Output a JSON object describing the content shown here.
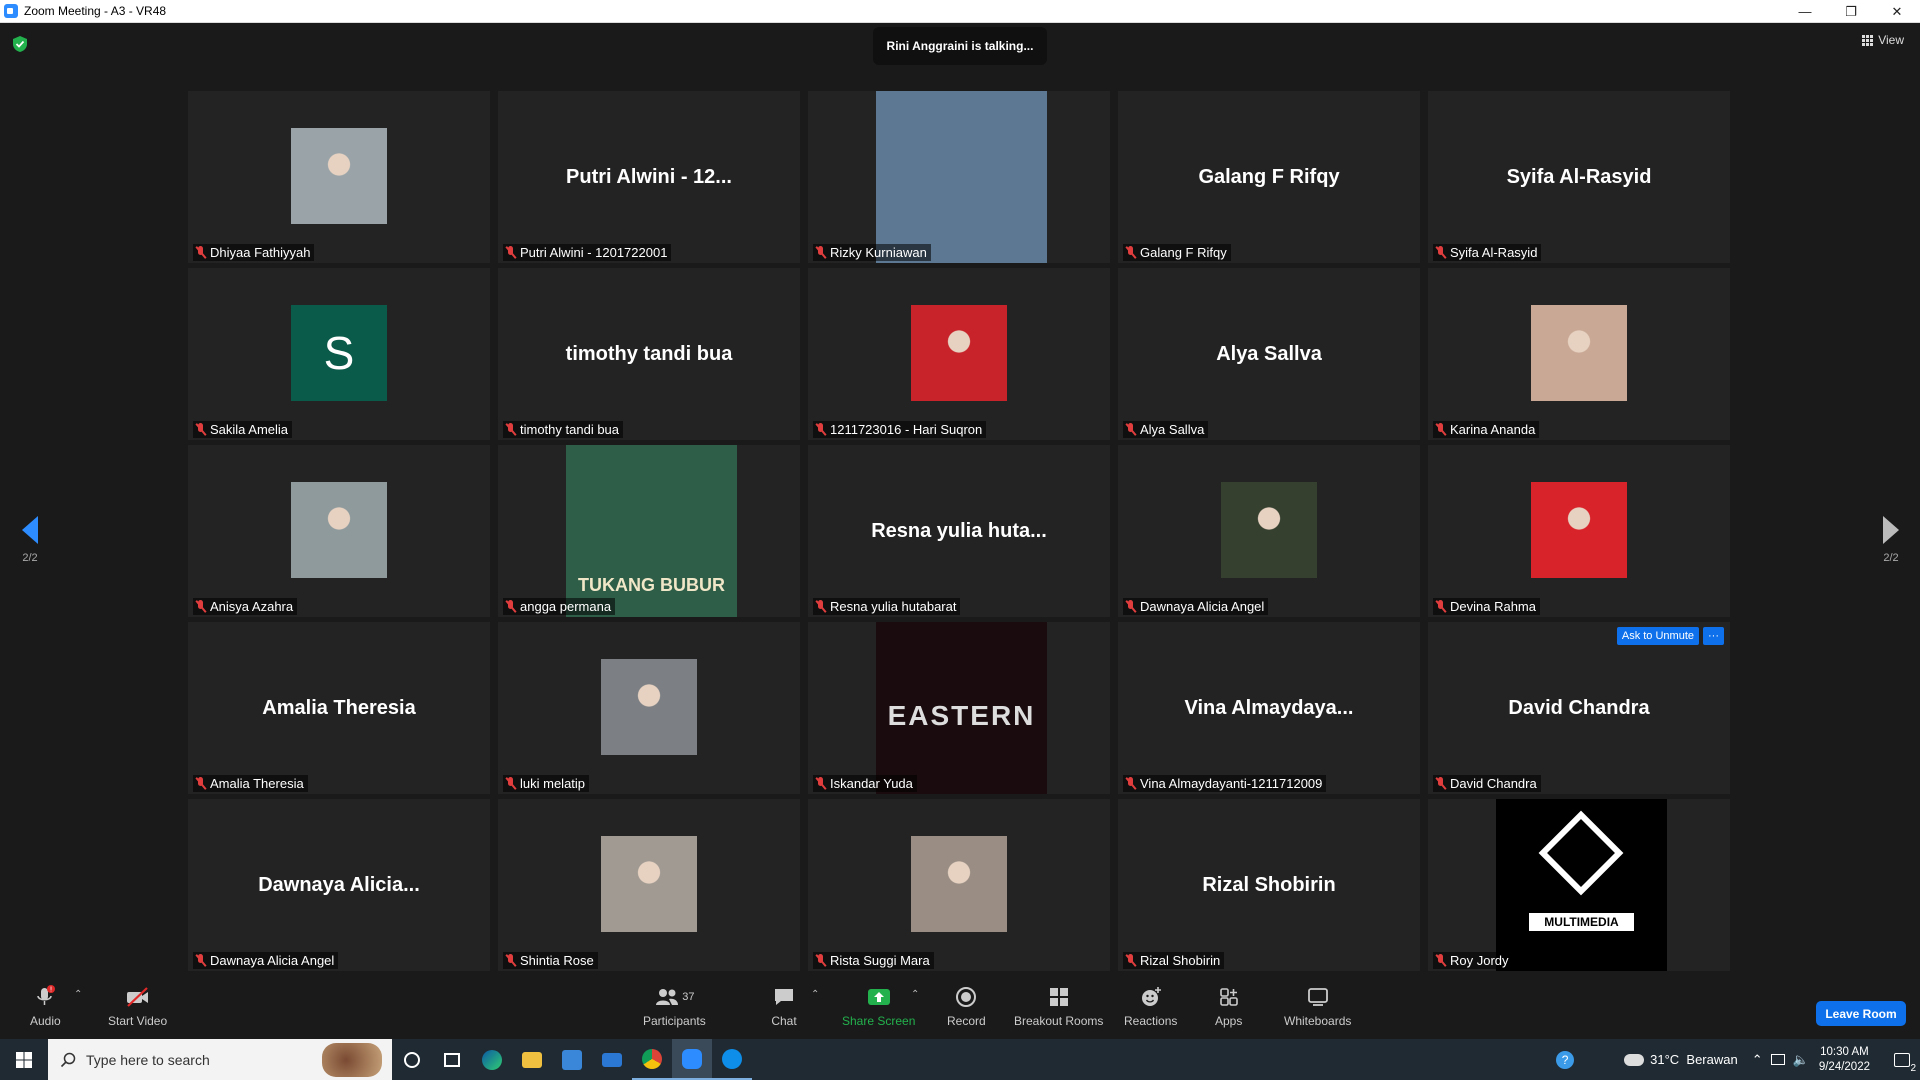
{
  "window": {
    "title": "Zoom Meeting - A3 - VR48"
  },
  "meeting": {
    "talking_indicator": "Rini Anggraini is talking...",
    "view_label": "View",
    "page_left": "2/2",
    "page_right": "2/2"
  },
  "tiles": [
    {
      "type": "photo",
      "name": "Dhiyaa Fathiyyah",
      "color": "#9aa4a8"
    },
    {
      "type": "text",
      "display": "Putri Alwini - 12...",
      "name": "Putri Alwini - 1201722001"
    },
    {
      "type": "video",
      "name": "Rizky Kurniawan",
      "color": "#5d7892"
    },
    {
      "type": "text",
      "display": "Galang F Rifqy",
      "name": "Galang F Rifqy"
    },
    {
      "type": "text",
      "display": "Syifa Al-Rasyid",
      "name": "Syifa Al-Rasyid"
    },
    {
      "type": "avatar",
      "letter": "S",
      "name": "Sakila Amelia",
      "color": "#0b5b4a"
    },
    {
      "type": "text",
      "display": "timothy tandi bua",
      "name": "timothy tandi bua"
    },
    {
      "type": "photo",
      "name": "1211723016 - Hari Suqron",
      "color": "#c8232a"
    },
    {
      "type": "text",
      "display": "Alya Sallva",
      "name": "Alya Sallva"
    },
    {
      "type": "photo",
      "name": "Karina Ananda",
      "color": "#c9a996"
    },
    {
      "type": "photo",
      "name": "Anisya Azahra",
      "color": "#8e9a9c"
    },
    {
      "type": "video",
      "name": "angga permana",
      "overlay": "TUKANG BUBUR",
      "color": "#2f5e48"
    },
    {
      "type": "text",
      "display": "Resna yulia huta...",
      "name": "Resna yulia hutabarat"
    },
    {
      "type": "photo",
      "name": "Dawnaya Alicia Angel",
      "color": "#36402f"
    },
    {
      "type": "photo",
      "name": "Devina Rahma",
      "color": "#d8232a"
    },
    {
      "type": "text",
      "display": "Amalia Theresia",
      "name": "Amalia Theresia"
    },
    {
      "type": "photo",
      "name": "luki melatip",
      "color": "#7c8084"
    },
    {
      "type": "video",
      "name": "Iskandar Yuda",
      "overlay": "EASTERN",
      "color": "#1a0c0e"
    },
    {
      "type": "text",
      "display": "Vina Almaydaya...",
      "name": "Vina Almaydayanti-1211712009"
    },
    {
      "type": "text",
      "display": "David Chandra",
      "name": "David Chandra",
      "ask": "Ask to Unmute",
      "more": "···"
    },
    {
      "type": "text",
      "display": "Dawnaya Alicia...",
      "name": "Dawnaya Alicia Angel"
    },
    {
      "type": "photo",
      "name": "Shintia Rose",
      "color": "#a09a92"
    },
    {
      "type": "photo",
      "name": "Rista Suggi Mara",
      "color": "#9a8e84"
    },
    {
      "type": "text",
      "display": "Rizal Shobirin",
      "name": "Rizal Shobirin"
    },
    {
      "type": "video",
      "name": "Roy Jordy",
      "overlay": "MULTIMEDIA",
      "color": "#000000"
    }
  ],
  "toolbar": {
    "audio": "Audio",
    "start_video": "Start Video",
    "participants": "Participants",
    "participants_count": "37",
    "chat": "Chat",
    "share_screen": "Share Screen",
    "record": "Record",
    "breakout_rooms": "Breakout Rooms",
    "reactions": "Reactions",
    "apps": "Apps",
    "whiteboards": "Whiteboards",
    "leave_room": "Leave Room"
  },
  "taskbar": {
    "search_placeholder": "Type here to search",
    "weather": "31°C  Berawan",
    "time": "10:30 AM",
    "date": "9/24/2022",
    "notification_count": "2"
  }
}
